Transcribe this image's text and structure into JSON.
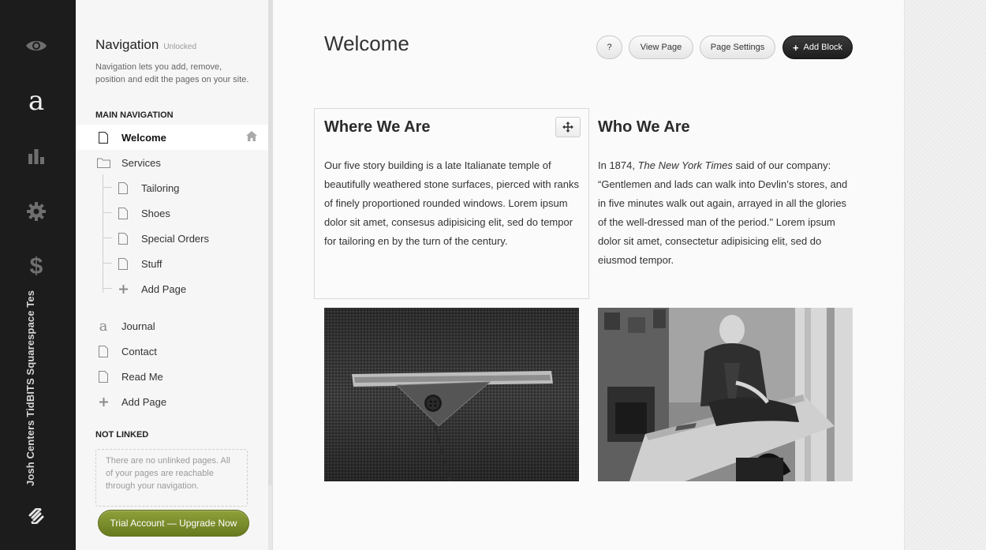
{
  "rail": {
    "site_name": "Josh Centers TidBITS Squarespace Tes",
    "icons": [
      "eye-icon",
      "squarespace-a-icon",
      "analytics-icon",
      "gear-icon",
      "dollar-icon",
      "squarespace-logo-icon"
    ],
    "a_glyph": "a",
    "dollar_glyph": "$"
  },
  "navigation": {
    "title": "Navigation",
    "status": "Unlocked",
    "description": "Navigation lets you add, remove, position and edit the pages on your site.",
    "main_label": "MAIN NAVIGATION",
    "items": [
      {
        "label": "Welcome",
        "icon": "page-icon",
        "active": true,
        "home": true
      },
      {
        "label": "Services",
        "icon": "folder-icon"
      },
      {
        "label": "Tailoring",
        "icon": "page-icon"
      },
      {
        "label": "Shoes",
        "icon": "page-icon"
      },
      {
        "label": "Special Orders",
        "icon": "page-icon"
      },
      {
        "label": "Stuff",
        "icon": "page-icon"
      },
      {
        "label": "Add Page",
        "icon": "plus-icon"
      },
      {
        "label": "Journal",
        "icon": "blog-a-icon"
      },
      {
        "label": "Contact",
        "icon": "page-icon"
      },
      {
        "label": "Read Me",
        "icon": "page-icon"
      },
      {
        "label": "Add Page",
        "icon": "plus-icon"
      }
    ],
    "not_linked_label": "NOT LINKED",
    "not_linked_text": "There are no unlinked pages. All of your pages are reachable through your navigation.",
    "upgrade_label": "Trial Account — Upgrade Now"
  },
  "main": {
    "title": "Welcome",
    "buttons": {
      "help": "?",
      "view_page": "View Page",
      "page_settings": "Page Settings",
      "add_block": "Add Block",
      "add_block_plus": "+"
    },
    "blocks": [
      {
        "heading": "Where We Are",
        "body": "Our five story building is a late Italianate temple of beautifully weathered stone surfaces, pierced with ranks of finely proportioned rounded windows. Lorem ipsum dolor sit amet, consesus adipisicing elit, sed do tempor for tailoring en by the turn of the century."
      },
      {
        "heading": "Who We Are",
        "body_prefix": "In 1874, ",
        "body_em": "The New York Times",
        "body_suffix": " said of our company: “Gentlemen and lads can walk into Devlin’s stores, and in five minutes walk out again, arrayed in all the glories of the well-dressed man of the period.\" Lorem ipsum dolor sit amet, consectetur adipisicing elit, sed do eiusmod tempor."
      }
    ],
    "images": [
      "suit-pocket-photo",
      "tailor-at-work-photo"
    ]
  },
  "colors": {
    "rail_bg": "#1c1c1c",
    "upgrade_green": "#7a8c2b",
    "dark_button": "#222222"
  }
}
